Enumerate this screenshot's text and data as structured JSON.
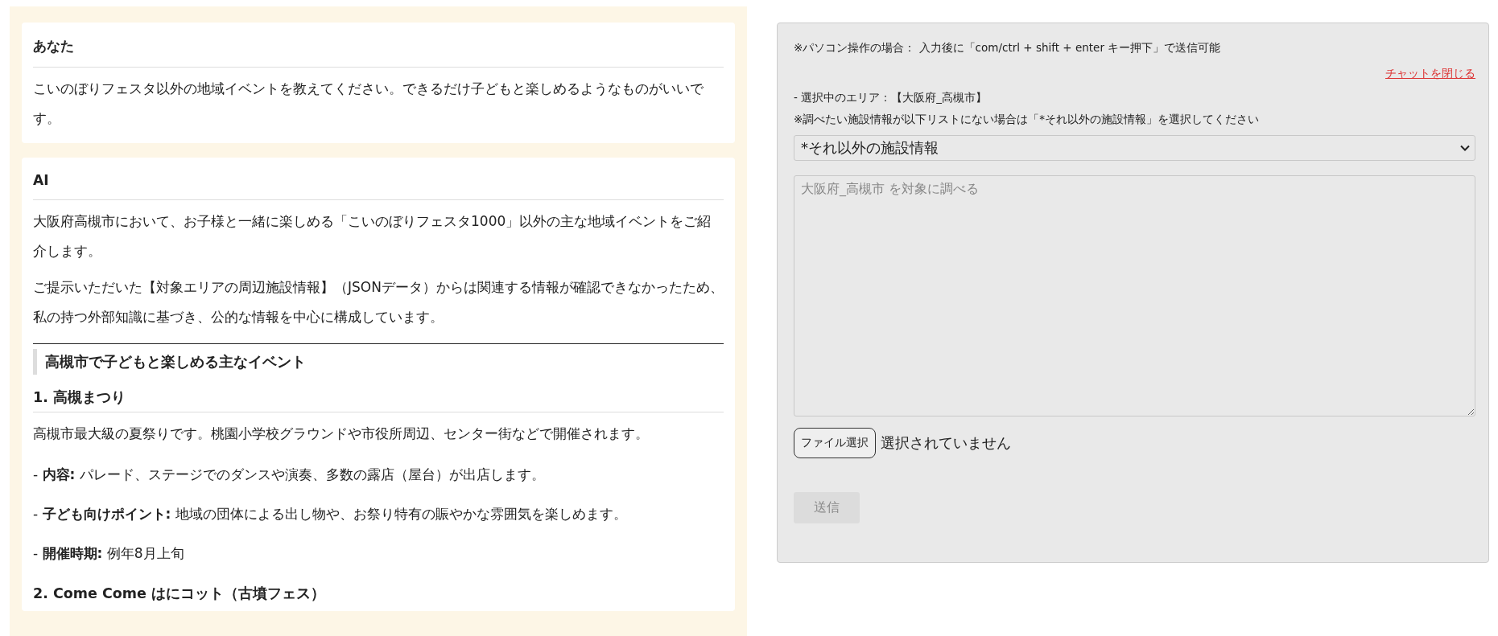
{
  "messages": [
    {
      "sender": "あなた",
      "blocks": [
        {
          "kind": "paragraph",
          "text": "こいのぼりフェスタ以外の地域イベントを教えてください。できるだけ子どもと楽しめるようなものがいいです。"
        }
      ]
    },
    {
      "sender": "AI",
      "blocks": [
        {
          "kind": "paragraph",
          "text": "大阪府高槻市において、お子様と一緒に楽しめる「こいのぼりフェスタ1000」以外の主な地域イベントをご紹介します。"
        },
        {
          "kind": "paragraph",
          "text": "ご提示いただいた【対象エリアの周辺施設情報】（JSONデータ）からは関連する情報が確認できなかったため、私の持つ外部知識に基づき、公的な情報を中心に構成しています。"
        },
        {
          "kind": "section",
          "text": "高槻市で子どもと楽しめる主なイベント"
        },
        {
          "kind": "heading",
          "text": "1. 高槻まつり"
        },
        {
          "kind": "paragraph",
          "text": "高槻市最大級の夏祭りです。桃園小学校グラウンドや市役所周辺、センター街などで開催されます。"
        },
        {
          "kind": "bullet",
          "text": "-  **内容:** パレード、ステージでのダンスや演奏、多数の露店（屋台）が出店します。"
        },
        {
          "kind": "bullet",
          "text": "-  **子ども向けポイント:** 地域の団体による出し物や、お祭り特有の賑やかな雰囲気を楽しめます。"
        },
        {
          "kind": "bullet",
          "text": "-  **開催時期:** 例年8月上旬"
        },
        {
          "kind": "heading_plain",
          "text": "2. Come Come はにコット（古墳フェス）"
        }
      ]
    }
  ],
  "panel": {
    "shortcut_note": "※パソコン操作の場合： 入力後に「com/ctrl + shift + enter キー押下」で送信可能",
    "close_link": "チャットを閉じる",
    "area_label": "- 選択中のエリア：【大阪府_高槻市】",
    "select_hint": "※調べたい施設情報が以下リストにない場合は「*それ以外の施設情報」を選択してください",
    "select_value": "*それ以外の施設情報",
    "query": {
      "placeholder": "大阪府_高槻市 を対象に調べる"
    },
    "file_button": "ファイル選択",
    "file_status": "選択されていません",
    "send_button": {
      "label": "送信",
      "disabled": true
    }
  }
}
